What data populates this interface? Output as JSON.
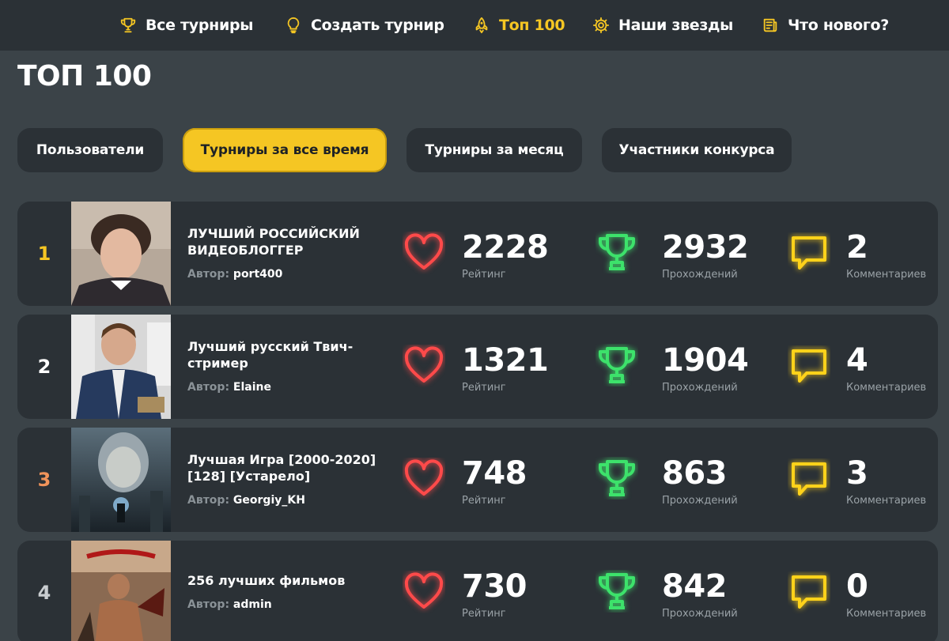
{
  "nav": {
    "items": [
      {
        "label": "Все турниры",
        "icon": "trophy-icon",
        "active": false
      },
      {
        "label": "Создать турнир",
        "icon": "lightbulb-icon",
        "active": false
      },
      {
        "label": "Топ 100",
        "icon": "rocket-icon",
        "active": true
      },
      {
        "label": "Наши звезды",
        "icon": "gear-icon",
        "active": false
      },
      {
        "label": "Что нового?",
        "icon": "newspaper-icon",
        "active": false
      }
    ]
  },
  "page": {
    "title": "ТОП 100"
  },
  "tabs": [
    {
      "label": "Пользователи",
      "active": false
    },
    {
      "label": "Турниры за все время",
      "active": true
    },
    {
      "label": "Турниры за месяц",
      "active": false
    },
    {
      "label": "Участники конкурса",
      "active": false
    }
  ],
  "labels": {
    "author_prefix": "Автор:",
    "rating": "Рейтинг",
    "passes": "Прохождений",
    "comments": "Комментариев"
  },
  "rows": [
    {
      "rank": "1",
      "rank_color": "#f5c623",
      "title": "ЛУЧШИЙ РОССИЙСКИЙ ВИДЕОБЛОГГЕР",
      "author": "port400",
      "rating": "2228",
      "passes": "2932",
      "comments": "2"
    },
    {
      "rank": "2",
      "rank_color": "#ffffff",
      "title": "Лучший русский Твич-стример",
      "author": "Elaine",
      "rating": "1321",
      "passes": "1904",
      "comments": "4"
    },
    {
      "rank": "3",
      "rank_color": "#f0935a",
      "title": "Лучшая Игра [2000-2020] [128] [Устарело]",
      "author": "Georgiy_KH",
      "rating": "748",
      "passes": "863",
      "comments": "3"
    },
    {
      "rank": "4",
      "rank_color": "#c9cdd0",
      "title": "256 лучших фильмов",
      "author": "admin",
      "rating": "730",
      "passes": "842",
      "comments": "0"
    }
  ],
  "colors": {
    "accent": "#f5c623",
    "heart": "#ff4a4a",
    "trophy": "#3de26b",
    "comment": "#ffd21a"
  }
}
